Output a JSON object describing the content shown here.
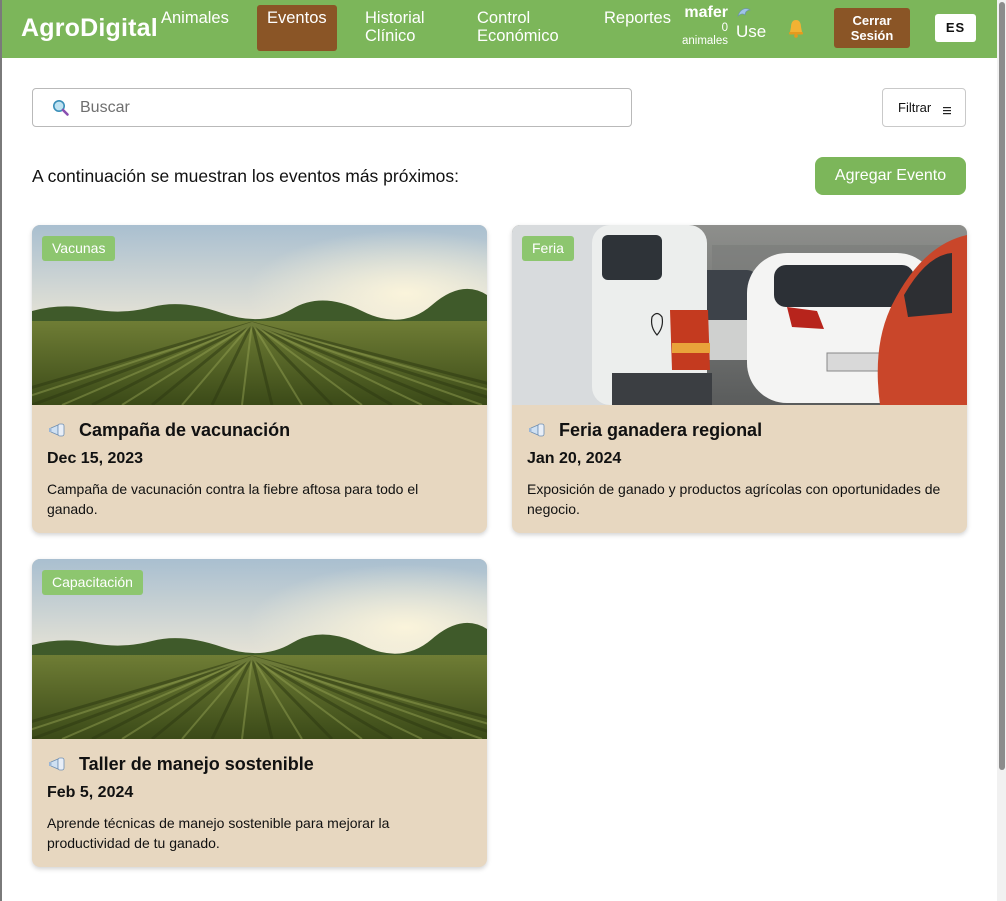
{
  "navbar": {
    "brand": "AgroDigital",
    "items": [
      {
        "label": "Animales"
      },
      {
        "label": "Eventos",
        "active": true
      },
      {
        "label": "Historial Clínico"
      },
      {
        "label": "Control Económico"
      },
      {
        "label": "Reportes"
      }
    ],
    "user": {
      "name": "mafer",
      "count": "0",
      "count_label": "animales"
    },
    "dolphin_label": "Use",
    "logout_label": "Cerrar Sesión",
    "language": "ES",
    "colors": {
      "bar": "#7cb65a",
      "active": "#8a5526",
      "button": "#8a5526"
    }
  },
  "search": {
    "placeholder": "Buscar",
    "value": ""
  },
  "filter": {
    "label": "Filtrar"
  },
  "intro_text": "A continuación se muestran los eventos más próximos:",
  "add_event_label": "Agregar Evento",
  "events": [
    {
      "tag": "Vacunas",
      "title": "Campaña de vacunación",
      "date": "Dec 15, 2023",
      "description": "Campaña de vacunación contra la fiebre aftosa para todo el ganado.",
      "image": "farm-field"
    },
    {
      "tag": "Feria",
      "title": "Feria ganadera regional",
      "date": "Jan 20, 2024",
      "description": "Exposición de ganado y productos agrícolas con oportunidades de negocio.",
      "image": "traffic-cars"
    },
    {
      "tag": "Capacitación",
      "title": "Taller de manejo sostenible",
      "date": "Feb 5, 2024",
      "description": "Aprende técnicas de manejo sostenible para mejorar la productividad de tu ganado.",
      "image": "farm-field"
    }
  ],
  "colors": {
    "card_bg": "#e7d7c0",
    "tag_bg": "#8dc66f",
    "accent": "#7cb65a"
  }
}
